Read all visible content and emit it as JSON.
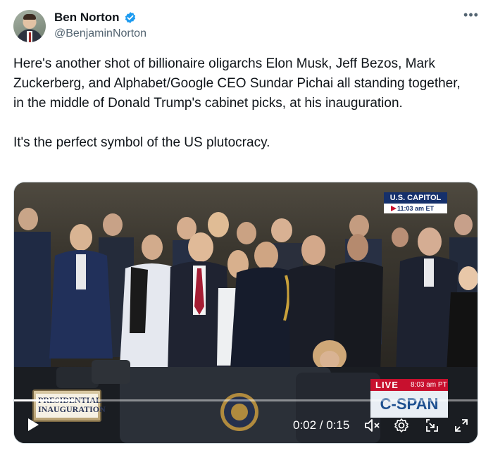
{
  "author": {
    "name": "Ben Norton",
    "handle": "@BenjaminNorton",
    "verified": true
  },
  "more_icon": "more-horizontal-icon",
  "post": {
    "paragraphs": [
      "Here's another shot of billionaire oligarchs Elon Musk, Jeff Bezos, Mark Zuckerberg, and Alphabet/Google CEO Sundar Pichai all standing together, in the middle of Donald Trump's cabinet picks, at his inauguration.",
      "It's the perfect symbol of the US plutocracy."
    ]
  },
  "video": {
    "bug_title": "U.S. CAPITOL",
    "bug_time": "11:03 am ET",
    "live_label": "LIVE",
    "live_time": "8:03 am PT",
    "network": "C-SPAN",
    "lower_third": "PRESIDENTIAL INAUGURATION",
    "time_display": "0:02 / 0:15",
    "progress_percent": 13,
    "controls": [
      "play-icon",
      "mute-icon",
      "settings-icon",
      "picture-in-picture-icon",
      "fullscreen-icon"
    ]
  },
  "colors": {
    "verified": "#1d9bf0",
    "secondary_text": "#536471",
    "capitol_blue": "#15306b",
    "live_red": "#c8102e"
  }
}
